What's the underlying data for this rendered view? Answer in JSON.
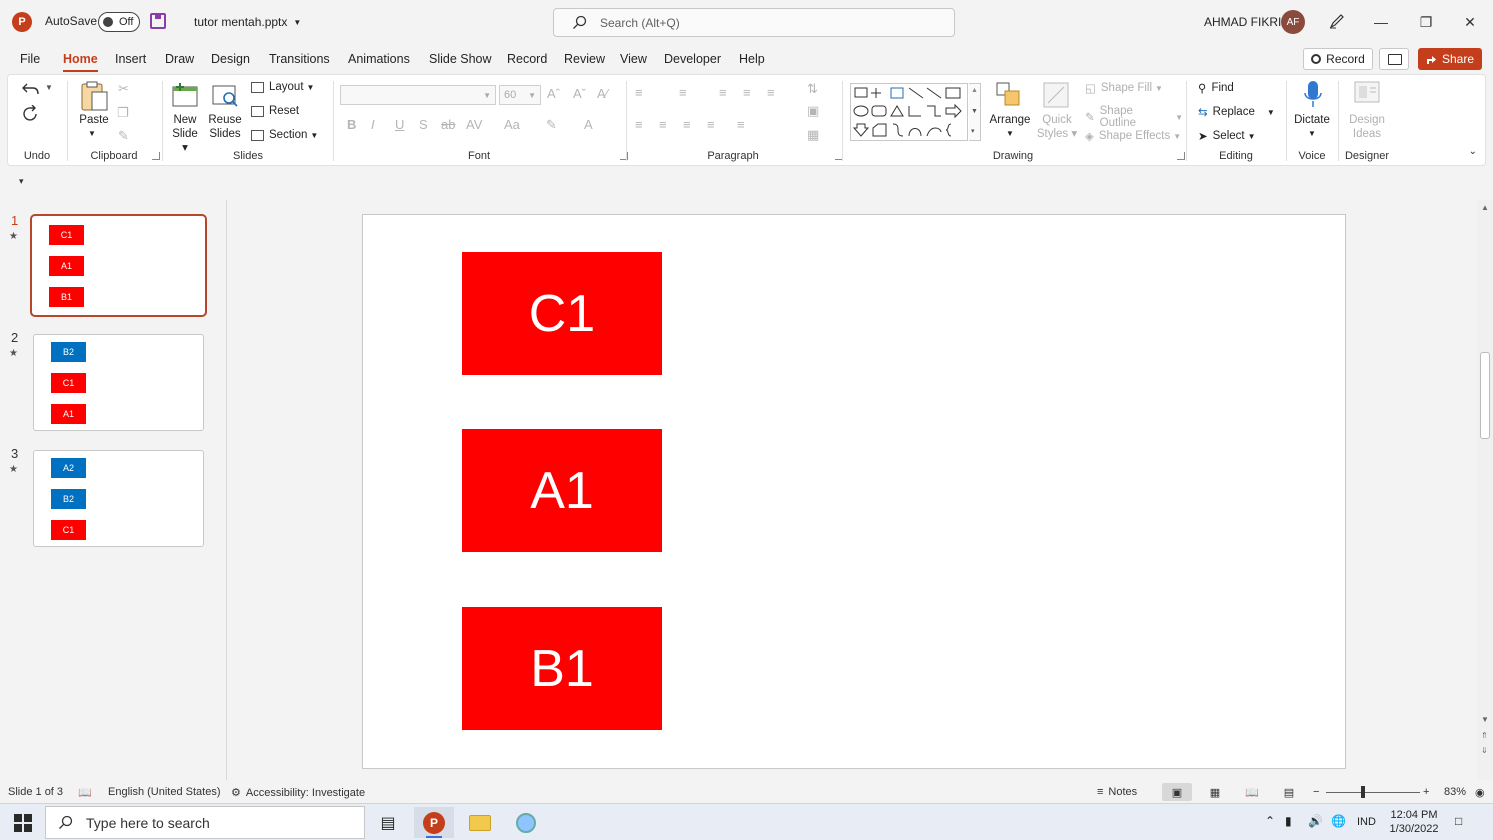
{
  "titlebar": {
    "app_icon": "powerpoint-icon",
    "autosave_label": "AutoSave",
    "autosave_state": "Off",
    "filename": "tutor mentah.pptx",
    "search_placeholder": "Search (Alt+Q)",
    "user_name": "AHMAD FIKRI",
    "user_initials": "AF"
  },
  "menu": {
    "tabs": [
      "File",
      "Home",
      "Insert",
      "Draw",
      "Design",
      "Transitions",
      "Animations",
      "Slide Show",
      "Record",
      "Review",
      "View",
      "Developer",
      "Help"
    ],
    "active_tab": "Home",
    "record_label": "Record",
    "share_label": "Share"
  },
  "ribbon": {
    "groups": {
      "undo": "Undo",
      "clipboard": "Clipboard",
      "slides": "Slides",
      "font": "Font",
      "paragraph": "Paragraph",
      "drawing": "Drawing",
      "editing": "Editing",
      "voice": "Voice",
      "designer": "Designer"
    },
    "paste": "Paste",
    "new_slide_1": "New",
    "new_slide_2": "Slide",
    "reuse_slides_1": "Reuse",
    "reuse_slides_2": "Slides",
    "layout": "Layout",
    "reset": "Reset",
    "section": "Section",
    "font_size": "60",
    "arrange": "Arrange",
    "quick_styles_1": "Quick",
    "quick_styles_2": "Styles",
    "shape_fill": "Shape Fill",
    "shape_outline": "Shape Outline",
    "shape_effects": "Shape Effects",
    "find": "Find",
    "replace": "Replace",
    "select": "Select",
    "dictate": "Dictate",
    "design_ideas_1": "Design",
    "design_ideas_2": "Ideas"
  },
  "thumbnails": [
    {
      "number": "1",
      "items": [
        {
          "label": "C1",
          "color": "#ff0000"
        },
        {
          "label": "A1",
          "color": "#ff0000"
        },
        {
          "label": "B1",
          "color": "#ff0000"
        }
      ]
    },
    {
      "number": "2",
      "items": [
        {
          "label": "B2",
          "color": "#0070c0"
        },
        {
          "label": "C1",
          "color": "#ff0000"
        },
        {
          "label": "A1",
          "color": "#ff0000"
        }
      ]
    },
    {
      "number": "3",
      "items": [
        {
          "label": "A2",
          "color": "#0070c0"
        },
        {
          "label": "B2",
          "color": "#0070c0"
        },
        {
          "label": "C1",
          "color": "#ff0000"
        }
      ]
    }
  ],
  "slide": {
    "shapes": [
      {
        "label": "C1",
        "color": "#ff0000"
      },
      {
        "label": "A1",
        "color": "#ff0000"
      },
      {
        "label": "B1",
        "color": "#ff0000"
      }
    ]
  },
  "statusbar": {
    "slide_counter": "Slide 1 of 3",
    "language": "English (United States)",
    "accessibility": "Accessibility: Investigate",
    "notes": "Notes",
    "zoom": "83%"
  },
  "taskbar": {
    "search_placeholder": "Type here to search",
    "language": "IND",
    "time": "12:04 PM",
    "date": "1/30/2022"
  },
  "colors": {
    "accent": "#c43e1c",
    "shape_red": "#ff0000",
    "shape_blue": "#0070c0"
  }
}
